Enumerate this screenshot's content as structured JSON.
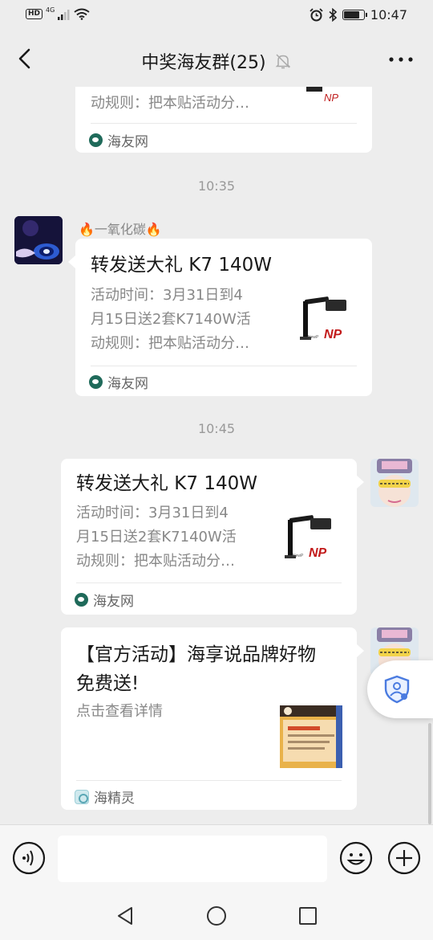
{
  "status_bar": {
    "left_badge": "HD",
    "network": "4G",
    "time": "10:47",
    "battery_level": 0.85
  },
  "header": {
    "title": "中奖海友群(25)",
    "back_icon": "chevron-left-icon",
    "mute_icon": "bell-off-icon",
    "more_icon": "more-dots-icon"
  },
  "messages": {
    "top_partial": {
      "desc_tail": "动规则：把本贴活动分…",
      "source": "海友网"
    },
    "time_1": "10:35",
    "msg_1": {
      "sender": "🔥一氧化碳🔥",
      "title": "转发送大礼 K7 140W",
      "desc": "活动时间：3月31日到4月15日送2套K7140W活动规则：把本贴活动分…",
      "desc_lines": [
        "活动时间：3月31日到4",
        "月15日送2套K7140W活",
        "动规则：把本贴活动分…"
      ],
      "source": "海友网"
    },
    "time_2": "10:45",
    "msg_2": {
      "title": "转发送大礼 K7 140W",
      "desc_lines": [
        "活动时间：3月31日到4",
        "月15日送2套K7140W活",
        "动规则：把本贴活动分…"
      ],
      "source": "海友网"
    },
    "msg_3": {
      "title_lines": [
        "【官方活动】海享说品牌好物",
        "免费送!"
      ],
      "desc": "点击查看详情",
      "source": "海精灵"
    }
  },
  "input_bar": {
    "voice_icon": "voice-icon",
    "input_value": "",
    "emoji_icon": "emoji-icon",
    "plus_icon": "plus-icon"
  },
  "system_nav": {
    "back_icon": "triangle-back-icon",
    "home_icon": "circle-home-icon",
    "recents_icon": "square-recents-icon"
  },
  "colors": {
    "background": "#ededed",
    "card": "#ffffff",
    "secondary_text": "#888888"
  }
}
